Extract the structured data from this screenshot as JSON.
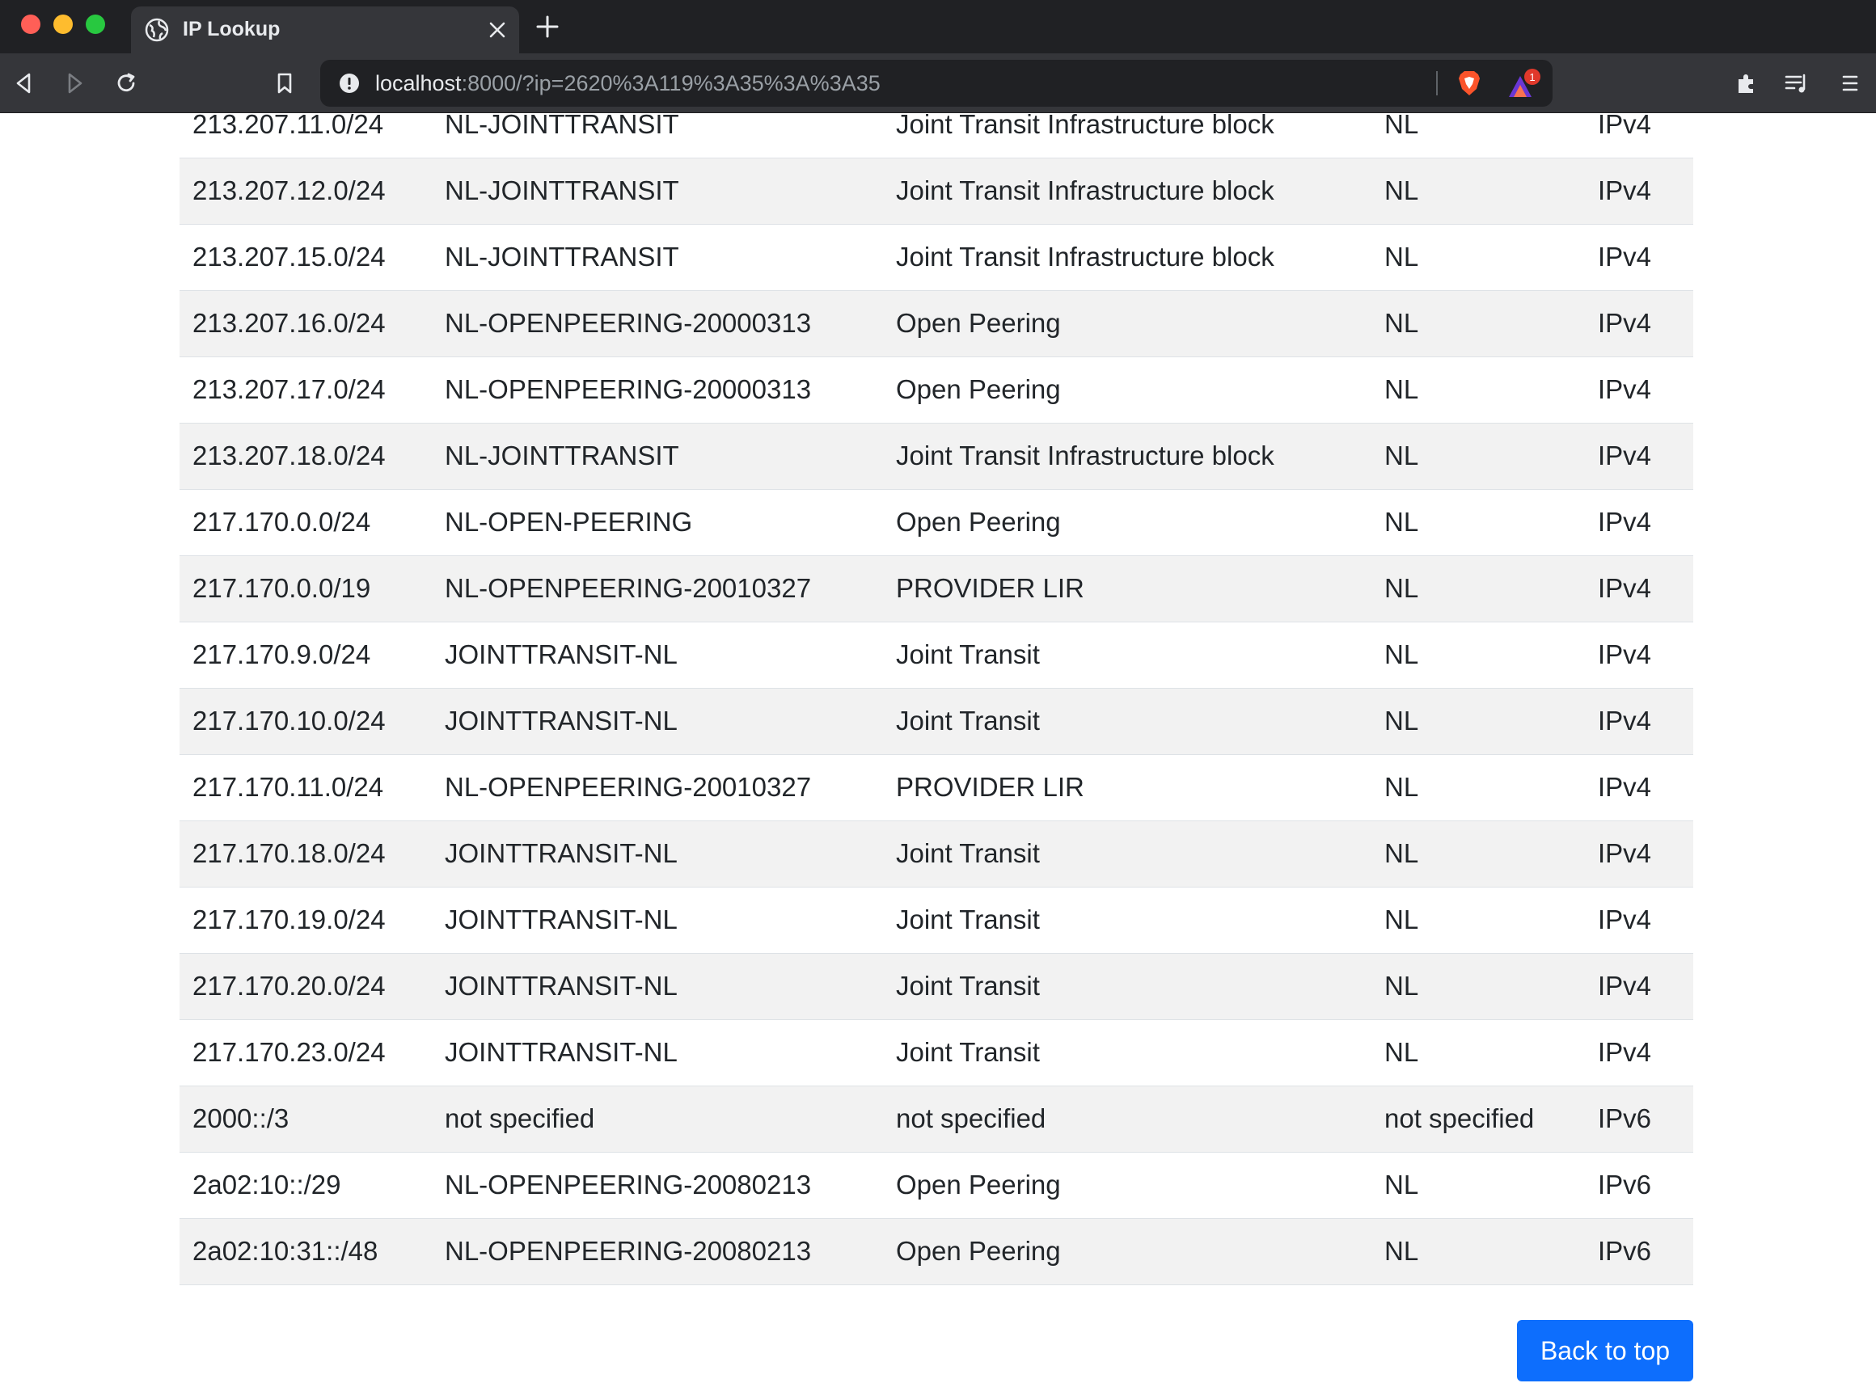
{
  "browser": {
    "tab_title": "IP Lookup",
    "url_host": "localhost",
    "url_rest": ":8000/?ip=2620%3A119%3A35%3A%3A35",
    "rewards_badge": "1"
  },
  "table": {
    "rows": [
      [
        "213.207.11.0/24",
        "NL-JOINTTRANSIT",
        "Joint Transit Infrastructure block",
        "NL",
        "IPv4"
      ],
      [
        "213.207.12.0/24",
        "NL-JOINTTRANSIT",
        "Joint Transit Infrastructure block",
        "NL",
        "IPv4"
      ],
      [
        "213.207.15.0/24",
        "NL-JOINTTRANSIT",
        "Joint Transit Infrastructure block",
        "NL",
        "IPv4"
      ],
      [
        "213.207.16.0/24",
        "NL-OPENPEERING-20000313",
        "Open Peering",
        "NL",
        "IPv4"
      ],
      [
        "213.207.17.0/24",
        "NL-OPENPEERING-20000313",
        "Open Peering",
        "NL",
        "IPv4"
      ],
      [
        "213.207.18.0/24",
        "NL-JOINTTRANSIT",
        "Joint Transit Infrastructure block",
        "NL",
        "IPv4"
      ],
      [
        "217.170.0.0/24",
        "NL-OPEN-PEERING",
        "Open Peering",
        "NL",
        "IPv4"
      ],
      [
        "217.170.0.0/19",
        "NL-OPENPEERING-20010327",
        "PROVIDER LIR",
        "NL",
        "IPv4"
      ],
      [
        "217.170.9.0/24",
        "JOINTTRANSIT-NL",
        "Joint Transit",
        "NL",
        "IPv4"
      ],
      [
        "217.170.10.0/24",
        "JOINTTRANSIT-NL",
        "Joint Transit",
        "NL",
        "IPv4"
      ],
      [
        "217.170.11.0/24",
        "NL-OPENPEERING-20010327",
        "PROVIDER LIR",
        "NL",
        "IPv4"
      ],
      [
        "217.170.18.0/24",
        "JOINTTRANSIT-NL",
        "Joint Transit",
        "NL",
        "IPv4"
      ],
      [
        "217.170.19.0/24",
        "JOINTTRANSIT-NL",
        "Joint Transit",
        "NL",
        "IPv4"
      ],
      [
        "217.170.20.0/24",
        "JOINTTRANSIT-NL",
        "Joint Transit",
        "NL",
        "IPv4"
      ],
      [
        "217.170.23.0/24",
        "JOINTTRANSIT-NL",
        "Joint Transit",
        "NL",
        "IPv4"
      ],
      [
        "2000::/3",
        "not specified",
        "not specified",
        "not specified",
        "IPv6"
      ],
      [
        "2a02:10::/29",
        "NL-OPENPEERING-20080213",
        "Open Peering",
        "NL",
        "IPv6"
      ],
      [
        "2a02:10:31::/48",
        "NL-OPENPEERING-20080213",
        "Open Peering",
        "NL",
        "IPv6"
      ]
    ]
  },
  "back_to_top_label": "Back to top",
  "colors": {
    "accent": "#0d6efd",
    "stripe": "#f2f2f2",
    "chrome_dark": "#202124",
    "chrome_toolbar": "#35363a"
  },
  "icons": [
    "globe-icon",
    "close-icon",
    "plus-icon",
    "back-icon",
    "forward-icon",
    "reload-icon",
    "bookmark-icon",
    "info-icon",
    "brave-shield-icon",
    "brave-rewards-icon",
    "extensions-icon",
    "playlist-icon",
    "menu-icon"
  ]
}
